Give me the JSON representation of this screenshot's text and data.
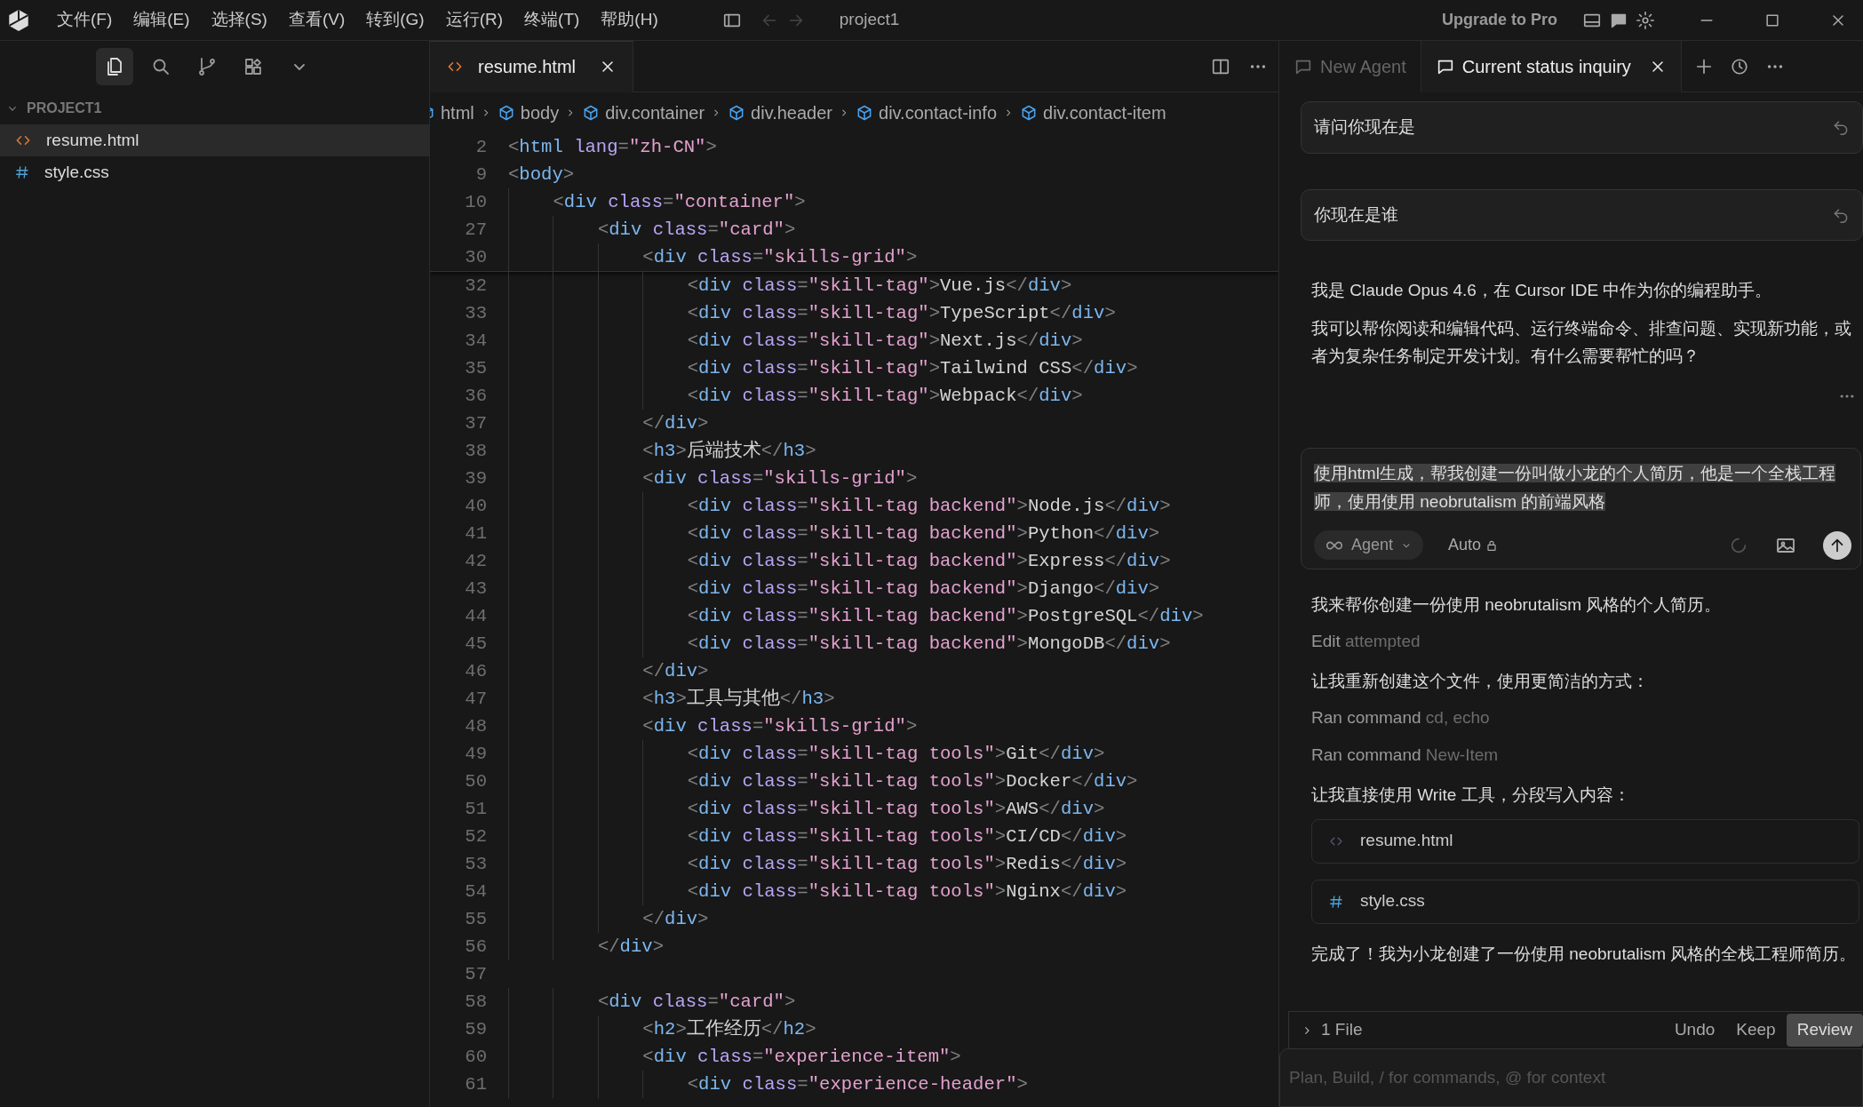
{
  "title_bar": {
    "menus": [
      "文件(F)",
      "编辑(E)",
      "选择(S)",
      "查看(V)",
      "转到(G)",
      "运行(R)",
      "终端(T)",
      "帮助(H)"
    ],
    "project": "project1",
    "upgrade": "Upgrade to Pro"
  },
  "sidebar": {
    "tools": [
      {
        "selected": true
      },
      {
        "selected": false
      },
      {
        "selected": false
      },
      {
        "selected": false
      },
      {
        "selected": false
      }
    ]
  },
  "explorer": {
    "folder": "PROJECT1",
    "expanded": true,
    "files": [
      {
        "name": "resume.html",
        "kind": "html",
        "selected": true
      },
      {
        "name": "style.css",
        "kind": "css",
        "selected": false
      }
    ]
  },
  "editor": {
    "tabs": [
      {
        "label": "resume.html",
        "kind": "html",
        "selected": true
      }
    ],
    "breadcrumbs": [
      "html",
      "body",
      "div.container",
      "div.header",
      "div.contact-info",
      "div.contact-item"
    ],
    "sticky_lines": [
      {
        "number": "2",
        "text": "<html lang=\"zh-CN\">"
      },
      {
        "number": "9",
        "text": "<body>"
      },
      {
        "number": "10",
        "text": "    <div class=\"container\">"
      },
      {
        "number": "27",
        "text": "        <div class=\"card\">"
      },
      {
        "number": "30",
        "text": "            <div class=\"skills-grid\">"
      }
    ],
    "lines": [
      {
        "number": "32",
        "text": "                <div class=\"skill-tag\">Vue.js</div>"
      },
      {
        "number": "33",
        "text": "                <div class=\"skill-tag\">TypeScript</div>"
      },
      {
        "number": "34",
        "text": "                <div class=\"skill-tag\">Next.js</div>"
      },
      {
        "number": "35",
        "text": "                <div class=\"skill-tag\">Tailwind CSS</div>"
      },
      {
        "number": "36",
        "text": "                <div class=\"skill-tag\">Webpack</div>"
      },
      {
        "number": "37",
        "text": "            </div>"
      },
      {
        "number": "38",
        "text": "            <h3>后端技术</h3>"
      },
      {
        "number": "39",
        "text": "            <div class=\"skills-grid\">"
      },
      {
        "number": "40",
        "text": "                <div class=\"skill-tag backend\">Node.js</div>"
      },
      {
        "number": "41",
        "text": "                <div class=\"skill-tag backend\">Python</div>"
      },
      {
        "number": "42",
        "text": "                <div class=\"skill-tag backend\">Express</div>"
      },
      {
        "number": "43",
        "text": "                <div class=\"skill-tag backend\">Django</div>"
      },
      {
        "number": "44",
        "text": "                <div class=\"skill-tag backend\">PostgreSQL</div>"
      },
      {
        "number": "45",
        "text": "                <div class=\"skill-tag backend\">MongoDB</div>"
      },
      {
        "number": "46",
        "text": "            </div>"
      },
      {
        "number": "47",
        "text": "            <h3>工具与其他</h3>"
      },
      {
        "number": "48",
        "text": "            <div class=\"skills-grid\">"
      },
      {
        "number": "49",
        "text": "                <div class=\"skill-tag tools\">Git</div>"
      },
      {
        "number": "50",
        "text": "                <div class=\"skill-tag tools\">Docker</div>"
      },
      {
        "number": "51",
        "text": "                <div class=\"skill-tag tools\">AWS</div>"
      },
      {
        "number": "52",
        "text": "                <div class=\"skill-tag tools\">CI/CD</div>"
      },
      {
        "number": "53",
        "text": "                <div class=\"skill-tag tools\">Redis</div>"
      },
      {
        "number": "54",
        "text": "                <div class=\"skill-tag tools\">Nginx</div>"
      },
      {
        "number": "55",
        "text": "            </div>"
      },
      {
        "number": "56",
        "text": "        </div>"
      },
      {
        "number": "57"
      },
      {
        "number": "58",
        "text": "        <div class=\"card\">"
      },
      {
        "number": "59",
        "text": "            <h2>工作经历</h2>"
      },
      {
        "number": "60",
        "text": "            <div class=\"experience-item\">"
      },
      {
        "number": "61",
        "text": "                <div class=\"experience-header\">"
      }
    ]
  },
  "agent": {
    "tabs": [
      {
        "label": "New Agent",
        "selected": false
      },
      {
        "label": "Current status inquiry",
        "selected": true
      }
    ],
    "messages": [
      {
        "kind": "user",
        "text": "请问你现在是"
      },
      {
        "kind": "user",
        "text": "你现在是谁"
      },
      {
        "kind": "assistant",
        "paragraphs": [
          "我是 Claude Opus 4.6，在 Cursor IDE 中作为你的编程助手。",
          "我可以帮你阅读和编辑代码、运行终端命令、排查问题、实现新功能，或者为复杂任务制定开发计划。有什么需要帮忙的吗？"
        ],
        "actions_menu": true
      },
      {
        "kind": "editing",
        "text": "使用html生成，帮我创建一份叫做小龙的个人简历，他是一个全栈工程师，使用使用 neobrutalism 的前端风格",
        "selected": true,
        "mode": "Agent",
        "model": "Auto"
      },
      {
        "kind": "assistant",
        "paragraphs": [
          "我来帮你创建一份使用 neobrutalism 风格的个人简历。"
        ]
      },
      {
        "kind": "tool",
        "action": "Edit",
        "detail": "attempted"
      },
      {
        "kind": "assistant",
        "paragraphs": [
          "让我重新创建这个文件，使用更简洁的方式："
        ]
      },
      {
        "kind": "tool",
        "action": "Ran command",
        "detail": "cd, echo"
      },
      {
        "kind": "tool",
        "action": "Ran command",
        "detail": "New-Item"
      },
      {
        "kind": "assistant",
        "paragraphs": [
          "让我直接使用 Write 工具，分段写入内容："
        ]
      },
      {
        "kind": "file",
        "file": {
          "name": "resume.html",
          "kind": "html"
        }
      },
      {
        "kind": "file",
        "file": {
          "name": "style.css",
          "kind": "css"
        }
      },
      {
        "kind": "assistant",
        "paragraphs": [
          "完成了！我为小龙创建了一份使用 neobrutalism 风格的全栈工程师简历。"
        ]
      }
    ],
    "changes": {
      "label": "1 File",
      "actions": [
        {
          "label": "Undo",
          "primary": false
        },
        {
          "label": "Keep",
          "primary": false
        },
        {
          "label": "Review",
          "primary": true
        }
      ]
    },
    "input": {
      "placeholder": "Plan, Build, / for commands, @ for context"
    }
  }
}
